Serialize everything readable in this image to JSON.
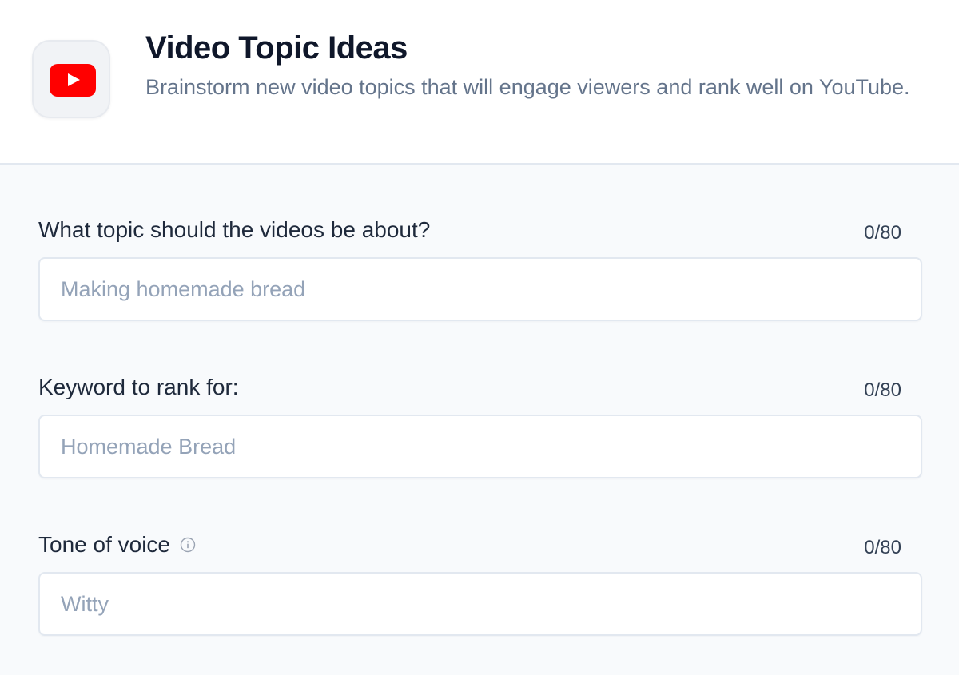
{
  "header": {
    "icon": "youtube-icon",
    "brand_color": "#ff0000",
    "title": "Video Topic Ideas",
    "subtitle": "Brainstorm new video topics that will engage viewers and rank well on YouTube."
  },
  "fields": [
    {
      "label": "What topic should the videos be about?",
      "counter": "0/80",
      "value": "",
      "placeholder": "Making homemade bread"
    },
    {
      "label": "Keyword to rank for:",
      "counter": "0/80",
      "value": "",
      "placeholder": "Homemade Bread"
    },
    {
      "label": "Tone of voice",
      "info_icon": "info-icon",
      "counter": "0/80",
      "value": "",
      "placeholder": "Witty"
    }
  ]
}
